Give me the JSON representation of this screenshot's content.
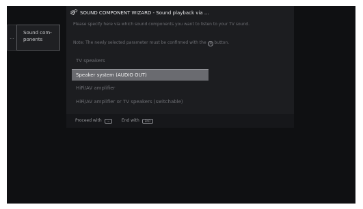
{
  "side_menu": {
    "dots": "...",
    "item_line1": "Sound com-",
    "item_line2": "ponents"
  },
  "wizard": {
    "title": "SOUND COMPONENT WIZARD - Sound playback via ...",
    "description": "Please specify here via which sound components you want to listen to your TV sound.",
    "note_before": "Note: The newly selected parameter must be confirmed with the",
    "note_key": "OK",
    "note_after": "button.",
    "options": [
      {
        "label": "TV speakers",
        "selected": false
      },
      {
        "label": "Speaker system (AUDIO OUT)",
        "selected": true
      },
      {
        "label": "HiFi/AV amplifier",
        "selected": false
      },
      {
        "label": "HiFi/AV amplifier or TV speakers (switchable)",
        "selected": false
      }
    ],
    "footer": {
      "proceed_label": "Proceed with",
      "proceed_key": "→",
      "end_label": "End with",
      "end_key": "END"
    }
  },
  "colors": {
    "screen_bg": "#0f1012",
    "panel_bg": "#1c1d20",
    "selected_bg": "#6a6b70"
  }
}
